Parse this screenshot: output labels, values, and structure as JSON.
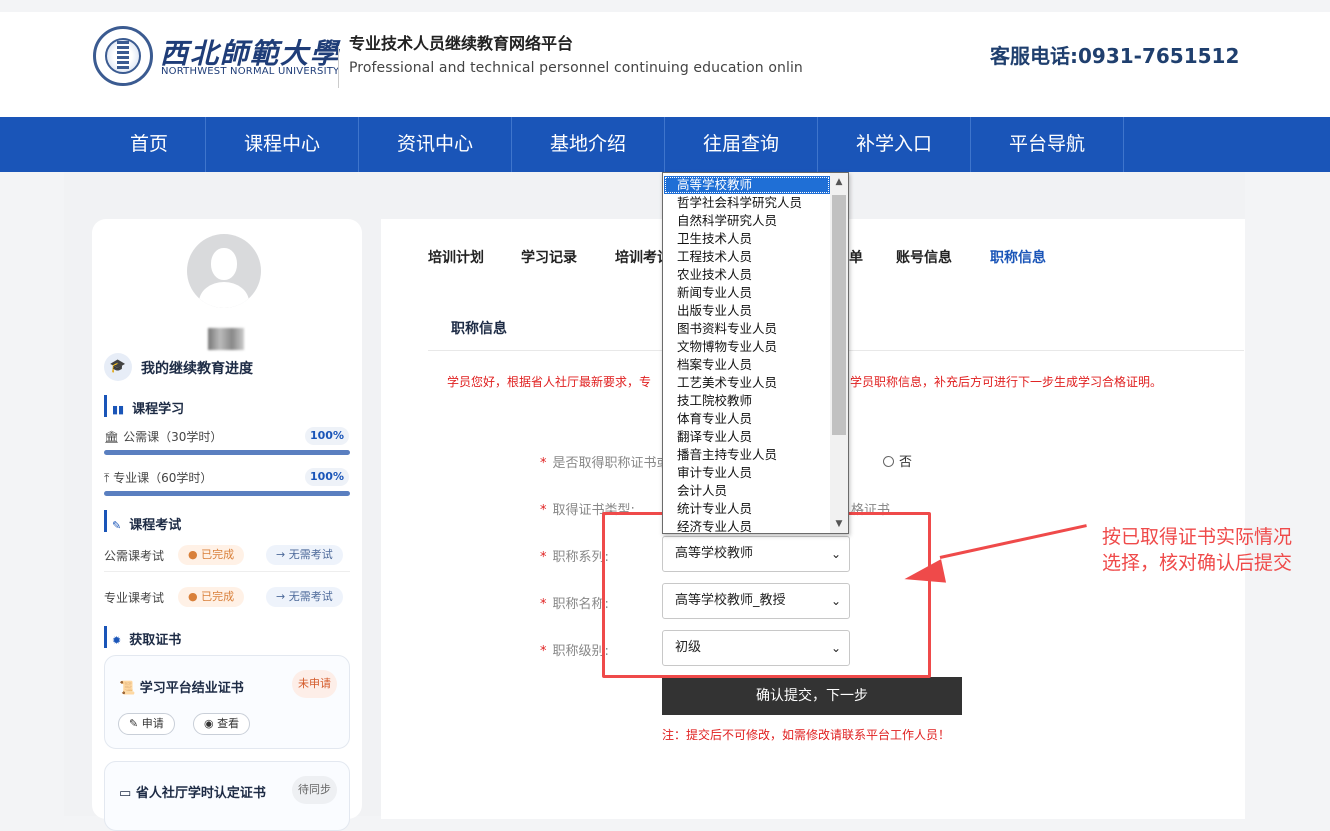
{
  "header": {
    "logo_cn": "西北師範大學",
    "logo_en": "NORTHWEST NORMAL UNIVERSITY",
    "platform_cn": "专业技术人员继续教育网络平台",
    "platform_en": "Professional and technical personnel continuing education onlin",
    "hotline": "客服电话:0931-7651512"
  },
  "nav": [
    "首页",
    "课程中心",
    "资讯中心",
    "基地介绍",
    "往届查询",
    "补学入口",
    "平台导航"
  ],
  "sidebar": {
    "progress_title": "我的继续教育进度",
    "study_title": "课程学习",
    "public_course": {
      "label": "公需课（30学时）",
      "pct": "100%",
      "value": 1.0
    },
    "major_course": {
      "label": "专业课（60学时）",
      "pct": "100%",
      "value": 1.0
    },
    "exam_title": "课程考试",
    "public_exam": {
      "label": "公需课考试",
      "status": "● 已完成",
      "action": "→ 无需考试"
    },
    "major_exam": {
      "label": "专业课考试",
      "status": "● 已完成",
      "action": "→ 无需考试"
    },
    "cert_title": "获取证书",
    "cert1": {
      "title": "学习平台结业证书",
      "tag": "未申请",
      "apply": "申请",
      "view": "查看"
    },
    "cert2": {
      "title": "省人社厅学时认定证书",
      "tag": "待同步"
    }
  },
  "tabs": {
    "t1": "培训计划",
    "t2": "学习记录",
    "t3": "培训考试",
    "t4": "单",
    "t5": "账号信息",
    "t6": "职称信息"
  },
  "subtab": "职称信息",
  "notice": {
    "left": "学员您好，根据省人社厅最新要求，专",
    "right": "学员职称信息，补充后方可进行下一步生成学习合格证明。"
  },
  "form": {
    "q1_label": "是否取得职称证书或",
    "q1_no": "否",
    "q2_label": "取得证书类型:",
    "q2_tail": "格证书",
    "series_label": "职称系列:",
    "series_value": "高等学校教师",
    "name_label": "职称名称:",
    "name_value": "高等学校教师_教授",
    "level_label": "职称级别:",
    "level_value": "初级",
    "submit": "确认提交，下一步",
    "warning": "注：提交后不可修改，如需修改请联系平台工作人员！"
  },
  "dropdown_options": [
    "高等学校教师",
    "哲学社会科学研究人员",
    "自然科学研究人员",
    "卫生技术人员",
    "工程技术人员",
    "农业技术人员",
    "新闻专业人员",
    "出版专业人员",
    "图书资料专业人员",
    "文物博物专业人员",
    "档案专业人员",
    "工艺美术专业人员",
    "技工院校教师",
    "体育专业人员",
    "翻译专业人员",
    "播音主持专业人员",
    "审计专业人员",
    "会计人员",
    "统计专业人员",
    "经济专业人员"
  ],
  "annotation": "按已取得证书实际情况选择，核对确认后提交",
  "colors": {
    "nav": "#1a55b8",
    "annotation": "#ef4a4a",
    "selected_option": "#1f6fd6"
  }
}
